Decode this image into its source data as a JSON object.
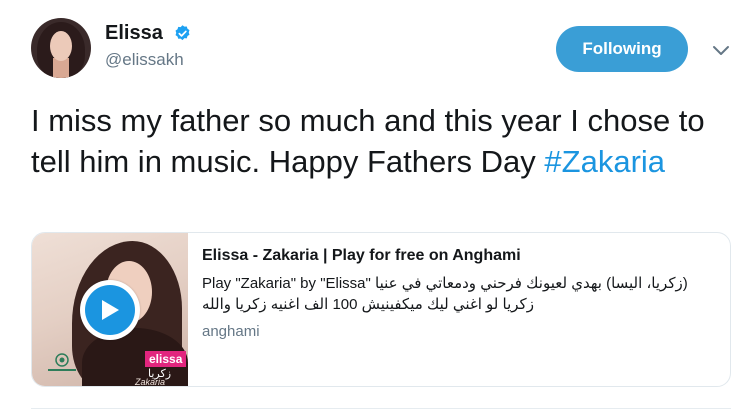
{
  "user": {
    "name": "Elissa",
    "handle": "@elissakh",
    "verified_icon": "verified-badge-icon"
  },
  "header": {
    "follow_label": "Following",
    "accent_color": "#3a9ed6",
    "menu_icon": "chevron-down-icon"
  },
  "tweet": {
    "text_before": "I miss my father so much and this year I chose to tell him in music. Happy Fathers Day ",
    "hashtag": "#Zakaria",
    "hashtag_color": "#1b95e0"
  },
  "card": {
    "title": "Elissa - Zakaria | Play for free on Anghami",
    "description_en": "Play \"Zakaria\" by \"Elissa\" ",
    "description_ar": "(زكريا، اليسا) بهدي لعيونك فرحني ودمعاتي في عنيا زكريا لو اغني ليك ميكفينيش 100 الف اغنيه زكريا والله",
    "domain": "anghami",
    "thumb_badge": "elissa",
    "thumb_arabic": "زكريا",
    "thumb_sub": "Zakaria",
    "play_icon": "play-icon"
  }
}
